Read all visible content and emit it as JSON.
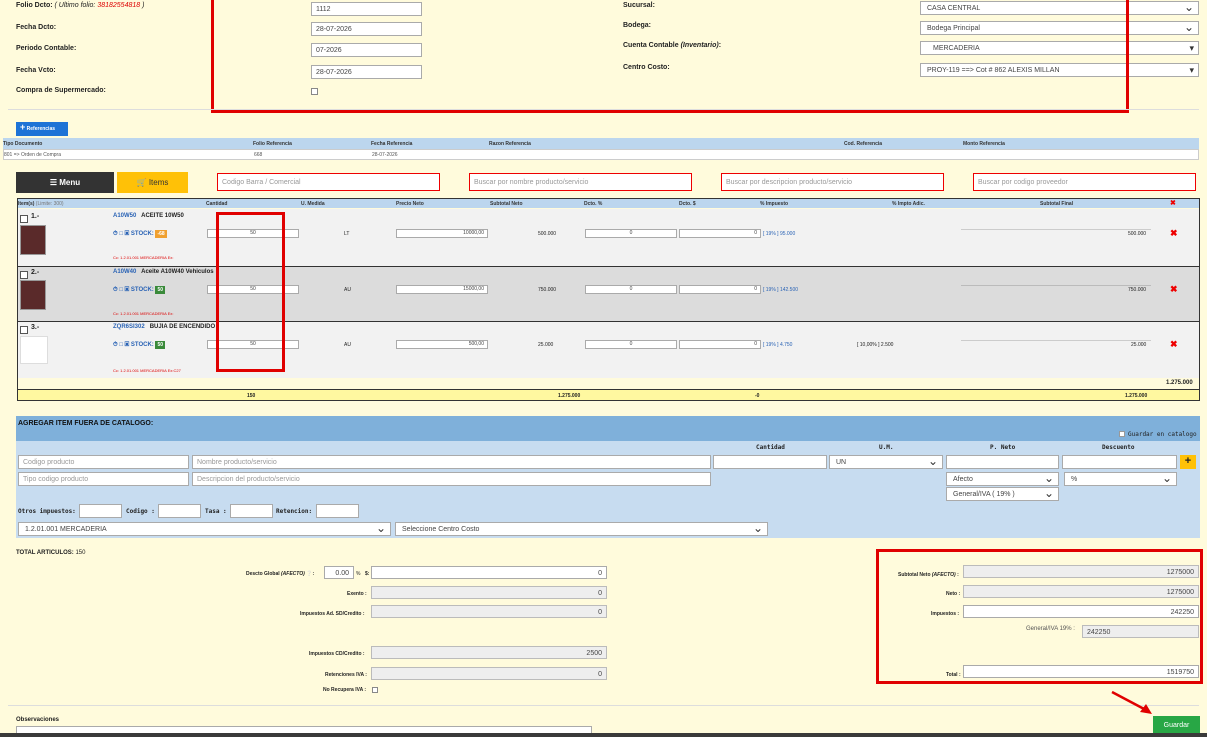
{
  "header": {
    "folio_label": "Folio Dcto:",
    "folio_hint_label": "( Ultimo folio: ",
    "folio_hint_value": "38182554818",
    "folio_hint_close": " )",
    "folio_value": "1112",
    "fecha_label": "Fecha Dcto:",
    "fecha_value": "28-07-2026",
    "periodo_label": "Periodo Contable:",
    "periodo_value": "07-2026",
    "vcto_label": "Fecha Vcto:",
    "vcto_value": "28-07-2026",
    "compra_label": "Compra de Supermercado:",
    "sucursal_label": "Sucursal:",
    "sucursal_value": "CASA CENTRAL",
    "bodega_label": "Bodega:",
    "bodega_value": "Bodega Principal",
    "cuenta_label": "Cuenta Contable",
    "cuenta_label_em": "(Inventario)",
    "cuenta_label_colon": ":",
    "cuenta_value": "MERCADERIA",
    "centro_label": "Centro Costo:",
    "centro_value": "PROY-119 ==> Cot # 862 ALEXIS MILLAN"
  },
  "referencias": {
    "button_label": "Referencias",
    "columns": [
      "Tipo Documento",
      "Folio Referencia",
      "Fecha Referencia",
      "Razon Referencia",
      "Cod. Referencia",
      "Monto Referencia"
    ],
    "row": [
      "801 => Orden de Compra",
      "668",
      "28-07-2026",
      "",
      "",
      ""
    ]
  },
  "toolbar": {
    "menu_label": "Menu",
    "items_label": "Items",
    "search_barcode": "Codigo Barra / Comercial",
    "search_name": "Buscar por nombre producto/servicio",
    "search_desc": "Buscar por descripcion producto/servicio",
    "search_prov": "Buscar por codigo proveedor"
  },
  "items_table": {
    "columns": [
      "Item(s)",
      "Cantidad",
      "U. Medida",
      "Precio Neto",
      "Subtotal Neto",
      "Dcto. %",
      "Dcto. $",
      "% Impuesto",
      "% Impto Adic.",
      "Subtotal Final"
    ],
    "item_hint": "(Limite: 300)",
    "stock_label": "STOCK:",
    "rows": [
      {
        "num": "1.-",
        "code": "A10W50",
        "name": "ACEITE 10W50",
        "qty": "50",
        "unit": "LT",
        "price": "10000,00",
        "subtotal": "500.000",
        "dpct": "0",
        "damt": "0",
        "tax": "[ 19% ] 95.000",
        "taxadic": "",
        "final": "500.000",
        "account": "Cc: 1.2.01.001 MERCADERIA Ex:",
        "stock": "-68",
        "stockcolor": "#f0a030"
      },
      {
        "num": "2.-",
        "code": "A10W40",
        "name": "Aceite A10W40 Vehiculos",
        "qty": "50",
        "unit": "AU",
        "price": "15000,00",
        "subtotal": "750.000",
        "dpct": "0",
        "damt": "0",
        "tax": "[ 19% ] 142.500",
        "taxadic": "",
        "final": "750.000",
        "account": "Cc: 1.2.01.001 MERCADERIA Ex:",
        "stock": "50",
        "stockcolor": "#3a8a3a"
      },
      {
        "num": "3.-",
        "code": "ZQR6SI302",
        "name": "BUJIA DE ENCENDIDO",
        "qty": "50",
        "unit": "AU",
        "price": "500,00",
        "subtotal": "25.000",
        "dpct": "0",
        "damt": "0",
        "tax": "[ 19% ] 4.750",
        "taxadic": "[ 10,00% ] 2.500",
        "final": "25.000",
        "account": "Cc: 1.2.01.001 MERCADERIA Ex:C27",
        "stock": "50",
        "stockcolor": "#3a8a3a"
      }
    ],
    "total_right": "1.275.000",
    "footer": {
      "qty": "150",
      "subtotal": "1.275.000",
      "dcto": "-0",
      "final": "1.275.000"
    }
  },
  "fuera_catalogo": {
    "title": "AGREGAR ITEM FUERA DE CATALOGO:",
    "guardar_label": "Guardar en catalogo",
    "col_cantidad": "Cantidad",
    "col_um": "U.M.",
    "col_pneto": "P. Neto",
    "col_descuento": "Descuento",
    "ph_codigo": "Codigo producto",
    "ph_nombre": "Nombre producto/servicio",
    "ph_tipo": "Tipo codigo producto",
    "ph_desc": "Descripcion del producto/servicio",
    "um_value": "UN",
    "afecto_value": "Afecto",
    "pct_value": "%",
    "iva_value": "General/IVA ( 19% )",
    "otros_label": "Otros impuestos:",
    "codigo_label": "Codigo :",
    "tasa_label": "Tasa :",
    "retencion_label": "Retencion:",
    "cuenta_value": "1.2.01.001    MERCADERIA",
    "centro_value": "Seleccione Centro Costo"
  },
  "totales": {
    "total_articulos_label": "TOTAL ARTICULOS:",
    "total_articulos_value": "150",
    "descto_label": "Descto Global",
    "descto_label_em": "(AFECTO)",
    "descto_pct": "0.00",
    "pct_sign": "%",
    "dollar_sign": "$:",
    "descto_amount": "0",
    "exento_label": "Exento :",
    "exento_value": "0",
    "impad_label": "Impuestos Ad. SD/Credito :",
    "impad_value": "0",
    "impcd_label": "Impuestos CD/Credito :",
    "impcd_value": "2500",
    "ret_label": "Retenciones IVA :",
    "ret_value": "0",
    "norec_label": "No Recupera IVA :",
    "subtotal_label": "Subtotal Neto",
    "subtotal_label_em": "(AFECTO)",
    "subtotal_label_colon": ":",
    "subtotal_value": "1275000",
    "neto_label": "Neto :",
    "neto_value": "1275000",
    "impuestos_label": "Impuestos :",
    "impuestos_value": "242250",
    "iva_label": "General/IVA 19% :",
    "iva_value": "242250",
    "total_label": "Total :",
    "total_value": "1519750"
  },
  "observaciones_label": "Observaciones",
  "guardar_label": "Guardar",
  "colors": {
    "highlight_red": "#e00000",
    "header_blue": "#bcd6ee",
    "accent_yellow": "#ffc107",
    "save_green": "#28a745"
  }
}
